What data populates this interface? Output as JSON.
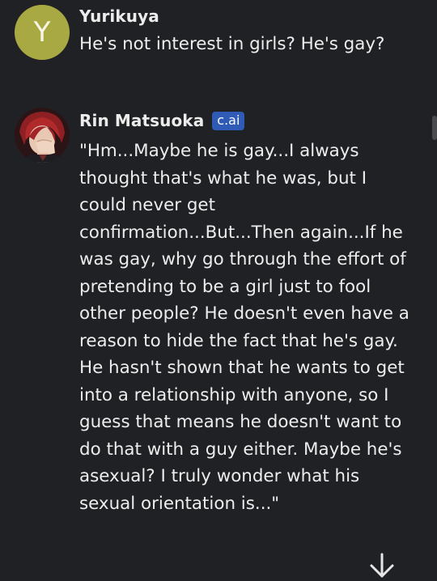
{
  "messages": [
    {
      "author": "Yurikuya",
      "avatar_letter": "Y",
      "text": "He's not interest in girls? He's gay?"
    },
    {
      "author": "Rin Matsuoka",
      "badge": "c.ai",
      "text": "\"Hm...Maybe he is gay...I always thought that's what he was, but I could never get confirmation...But...Then again...If he was gay, why go through the effort of pretending to be a girl just to fool other people? He doesn't even have a reason to hide the fact that he's gay. He hasn't shown that he wants to get into a relationship with anyone, so I guess that means he doesn't want to do that with a guy either. Maybe he's asexual? I truly wonder what his sexual orientation is...\""
    }
  ],
  "icons": {
    "scroll_down": "arrow-down-icon"
  },
  "colors": {
    "background": "#202124",
    "user_avatar": "#a9a944",
    "badge": "#2f5bb7",
    "text": "#ececec"
  }
}
